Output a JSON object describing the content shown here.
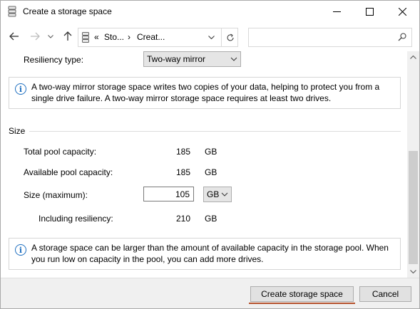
{
  "window": {
    "title": "Create a storage space",
    "icon": "storage-icon"
  },
  "nav": {
    "back_icon": "arrow-left-icon",
    "forward_icon": "arrow-right-icon",
    "recent_icon": "chevron-down-icon",
    "up_icon": "arrow-up-icon",
    "breadcrumb_prefix": "«",
    "crumbs": [
      "Sto...",
      "Creat..."
    ],
    "search_placeholder": ""
  },
  "form": {
    "resiliency_label": "Resiliency type:",
    "resiliency_value": "Two-way mirror",
    "resiliency_info": "A two-way mirror storage space writes two copies of your data, helping to protect you from a single drive failure. A two-way mirror storage space requires at least two drives.",
    "size_group_title": "Size",
    "total_label": "Total pool capacity:",
    "total_value": "185",
    "total_unit": "GB",
    "available_label": "Available pool capacity:",
    "available_value": "185",
    "available_unit": "GB",
    "size_label": "Size (maximum):",
    "size_value": "105",
    "size_unit": "GB",
    "resiliency_incl_label": "Including resiliency:",
    "resiliency_incl_value": "210",
    "resiliency_incl_unit": "GB",
    "size_info": "A storage space can be larger than the amount of available capacity in the storage pool. When you run low on capacity in the pool, you can add more drives."
  },
  "footer": {
    "create_label": "Create storage space",
    "cancel_label": "Cancel"
  },
  "colors": {
    "accent_underline": "#b5512b",
    "info_icon": "#1e6fc0"
  }
}
